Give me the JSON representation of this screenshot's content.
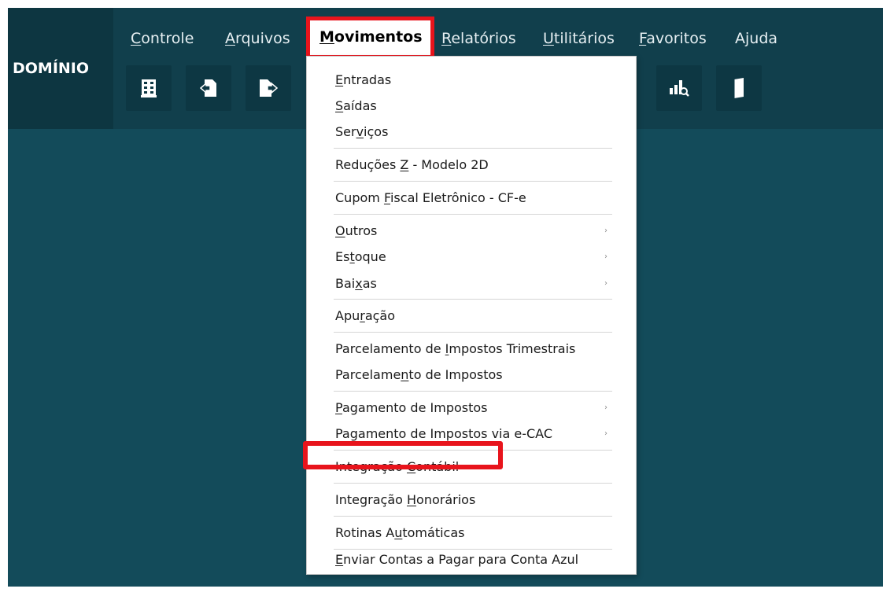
{
  "brand": {
    "name": "DOMÍNIO"
  },
  "menubar": [
    {
      "label": "Controle",
      "mnemonic": "C"
    },
    {
      "label": "Arquivos",
      "mnemonic": "A"
    },
    {
      "label": "Movimentos",
      "mnemonic": "M",
      "active": true
    },
    {
      "label": "Relatórios",
      "mnemonic": "R"
    },
    {
      "label": "Utilitários",
      "mnemonic": "U"
    },
    {
      "label": "Favoritos",
      "mnemonic": "F"
    },
    {
      "label": "Ajuda",
      "mnemonic": ""
    }
  ],
  "toolbar": [
    {
      "icon": "building-icon"
    },
    {
      "icon": "document-in-icon"
    },
    {
      "icon": "document-out-icon"
    },
    {
      "icon": "chart-search-icon"
    },
    {
      "icon": "book-icon"
    }
  ],
  "dropdown": {
    "items": [
      {
        "id": "entradas",
        "pre": "",
        "mn": "E",
        "post": "ntradas",
        "submenu": false
      },
      {
        "id": "saidas",
        "pre": "",
        "mn": "S",
        "post": "aídas",
        "submenu": false
      },
      {
        "id": "servicos",
        "pre": "Ser",
        "mn": "v",
        "post": "iços",
        "submenu": false
      },
      {
        "id": "reducoes-z",
        "pre": "Reduções ",
        "mn": "Z",
        "post": " - Modelo 2D",
        "submenu": false
      },
      {
        "id": "cupom-fiscal",
        "pre": "Cupom ",
        "mn": "F",
        "post": "iscal Eletrônico - CF-e",
        "submenu": false
      },
      {
        "id": "outros",
        "pre": "",
        "mn": "O",
        "post": "utros",
        "submenu": true
      },
      {
        "id": "estoque",
        "pre": "Es",
        "mn": "t",
        "post": "oque",
        "submenu": true
      },
      {
        "id": "baixas",
        "pre": "Bai",
        "mn": "x",
        "post": "as",
        "submenu": true
      },
      {
        "id": "apuracao",
        "pre": "Apu",
        "mn": "r",
        "post": "ação",
        "submenu": false
      },
      {
        "id": "parcelamento-trimestrais",
        "pre": "Parcelamento de ",
        "mn": "I",
        "post": "mpostos Trimestrais",
        "submenu": false
      },
      {
        "id": "parcelamento-impostos",
        "pre": "Parcelame",
        "mn": "n",
        "post": "to de Impostos",
        "submenu": false
      },
      {
        "id": "pagamento-impostos",
        "pre": "",
        "mn": "P",
        "post": "agamento de Impostos",
        "submenu": true
      },
      {
        "id": "pagamento-ecac",
        "pre": "Pagamento de Impostos via e-CAC",
        "mn": "",
        "post": "",
        "submenu": true
      },
      {
        "id": "integracao-contabil",
        "pre": "Integração ",
        "mn": "C",
        "post": "ontábil",
        "submenu": false,
        "highlighted": true
      },
      {
        "id": "integracao-honorarios",
        "pre": "Integração ",
        "mn": "H",
        "post": "onorários",
        "submenu": false
      },
      {
        "id": "rotinas-automaticas",
        "pre": "Rotinas A",
        "mn": "u",
        "post": "tomáticas",
        "submenu": false
      },
      {
        "id": "enviar-contas",
        "pre": "",
        "mn": "E",
        "post": "nviar Contas a Pagar para Conta Azul",
        "submenu": false
      }
    ],
    "submenu_arrow": "›"
  },
  "colors": {
    "header": "#113f4c",
    "workspace": "#134b5a",
    "highlight": "#e8141c"
  }
}
